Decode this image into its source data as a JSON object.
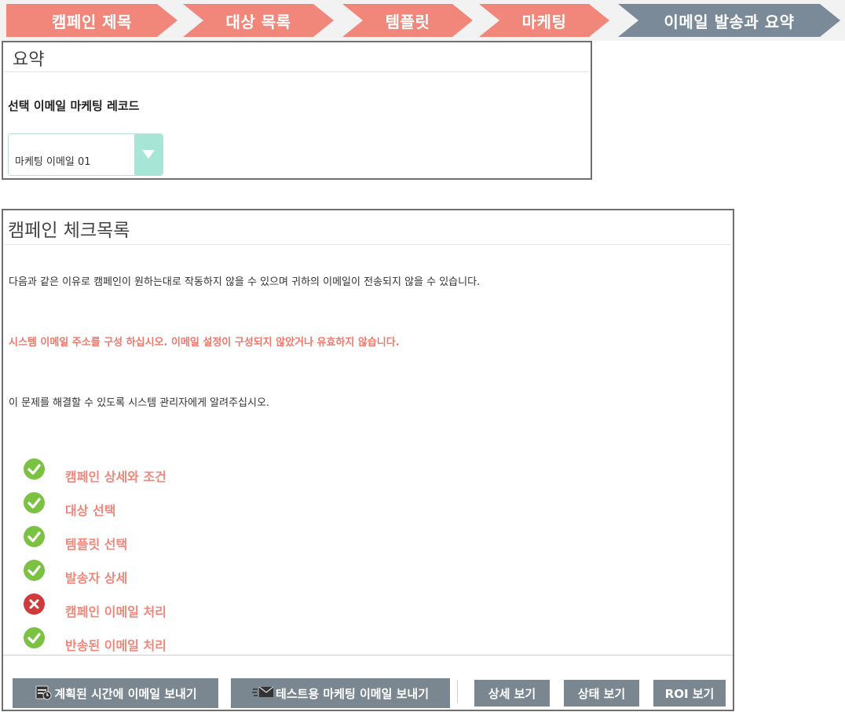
{
  "wizard": {
    "steps": [
      {
        "label": "캠페인 제목",
        "state": "done"
      },
      {
        "label": "대상 목록",
        "state": "done"
      },
      {
        "label": "템플릿",
        "state": "done"
      },
      {
        "label": "마케팅",
        "state": "done"
      },
      {
        "label": "이메일 발송과 요약",
        "state": "active"
      }
    ],
    "colors": {
      "done": "#f0877a",
      "active": "#7a8a99"
    }
  },
  "summary": {
    "title": "요약",
    "record_label": "선택 이메일 마케팅 레코드",
    "selected_record": "마케팅 이메일 01"
  },
  "checklist": {
    "title": "캠페인 체크목록",
    "intro": "다음과 같은 이유로 캠페인이 원하는대로 작동하지 않을 수 있으며 귀하의 이메일이 전송되지 않을 수 있습니다.",
    "warning": "시스템 이메일 주소를 구성 하십시오. 이메일 설정이 구성되지 않았거나 유효하지 않습니다.",
    "advice": "이 문제를 해결할 수 있도록 시스템 관리자에게 알려주십시오.",
    "items": [
      {
        "label": "캠페인 상세와 조건",
        "status": "ok",
        "icon": "check-circle-icon"
      },
      {
        "label": "대상 선택",
        "status": "ok",
        "icon": "check-circle-icon"
      },
      {
        "label": "템플릿 선택",
        "status": "ok",
        "icon": "check-circle-icon"
      },
      {
        "label": "발송자 상세",
        "status": "ok",
        "icon": "check-circle-icon"
      },
      {
        "label": "캠페인 이메일 처리",
        "status": "fail",
        "icon": "x-circle-icon"
      },
      {
        "label": "반송된 이메일 처리",
        "status": "ok",
        "icon": "check-circle-icon"
      }
    ]
  },
  "actions": {
    "schedule": "계획된 시간에 이메일 보내기",
    "test": "테스트용 마케팅 이메일 보내기",
    "details": "상세 보기",
    "status": "상태 보기",
    "roi": "ROI 보기"
  },
  "colors": {
    "accent": "#f0877a",
    "button": "#7a8790",
    "ok": "#7cc242",
    "fail": "#cf3b3b",
    "select_button": "#a7e6d6"
  }
}
